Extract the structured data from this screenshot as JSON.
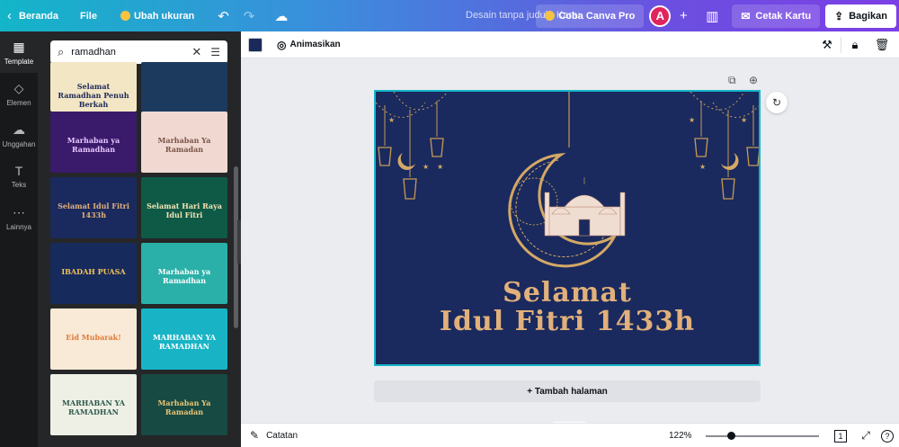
{
  "topbar": {
    "home_label": "Beranda",
    "file_label": "File",
    "resize_label": "Ubah ukuran",
    "doc_title": "Desain tanpa judul - Kartu",
    "pro_label": "Coba Canva Pro",
    "avatar_initial": "A",
    "print_label": "Cetak Kartu",
    "share_label": "Bagikan"
  },
  "rail": {
    "items": [
      {
        "label": "Template",
        "icon": "template-icon"
      },
      {
        "label": "Elemen",
        "icon": "elements-icon"
      },
      {
        "label": "Unggahan",
        "icon": "upload-icon"
      },
      {
        "label": "Teks",
        "icon": "text-icon"
      },
      {
        "label": "Lainnya",
        "icon": "more-icon"
      }
    ]
  },
  "panel": {
    "search_value": "ramadhan",
    "templates": [
      {
        "text": "Selamat Ramadhan Penuh Berkah",
        "bg": "#f3e6c4",
        "fg": "#1d2a5a"
      },
      {
        "text": "",
        "bg": "#1c3a5e",
        "fg": "#c9a86a"
      },
      {
        "text": "Marhaban ya Ramadhan",
        "bg": "#3a1a6b",
        "fg": "#e8c6ff"
      },
      {
        "text": "Marhaban Ya Ramadan",
        "bg": "#f1d9d2",
        "fg": "#7a5548"
      },
      {
        "text": "Selamat Idul Fitri 1433h",
        "bg": "#1a2a5e",
        "fg": "#e2b07a"
      },
      {
        "text": "Selamat Hari Raya Idul Fitri",
        "bg": "#0f5a46",
        "fg": "#f3e3b5"
      },
      {
        "text": "IBADAH PUASA",
        "bg": "#172a5c",
        "fg": "#f2c45a"
      },
      {
        "text": "Marhaban ya Ramadhan",
        "bg": "#2ab0a8",
        "fg": "#ffffff"
      },
      {
        "text": "Eid Mubarak!",
        "bg": "#f8ead7",
        "fg": "#e07a3a"
      },
      {
        "text": "MARHABAN YA RAMADHAN",
        "bg": "#18b4c6",
        "fg": "#ffffff"
      },
      {
        "text": "MARHABAN YA RAMADHAN",
        "bg": "#eef0e6",
        "fg": "#2e5a4c"
      },
      {
        "text": "Marhaban Ya Ramadan",
        "bg": "#174a42",
        "fg": "#e8c477"
      }
    ]
  },
  "toolbar": {
    "animate_label": "Animasikan",
    "text_color": "#1b2a5c"
  },
  "canvas": {
    "line1": "Selamat",
    "line2": "Idul Fitri 1433h",
    "bg_color": "#1a2a5e",
    "gold_color": "#e2b07a",
    "add_page_label": "+ Tambah halaman"
  },
  "bottombar": {
    "notes_label": "Catatan",
    "zoom": "122%",
    "zoom_fraction": 0.22,
    "page_count": "1"
  }
}
